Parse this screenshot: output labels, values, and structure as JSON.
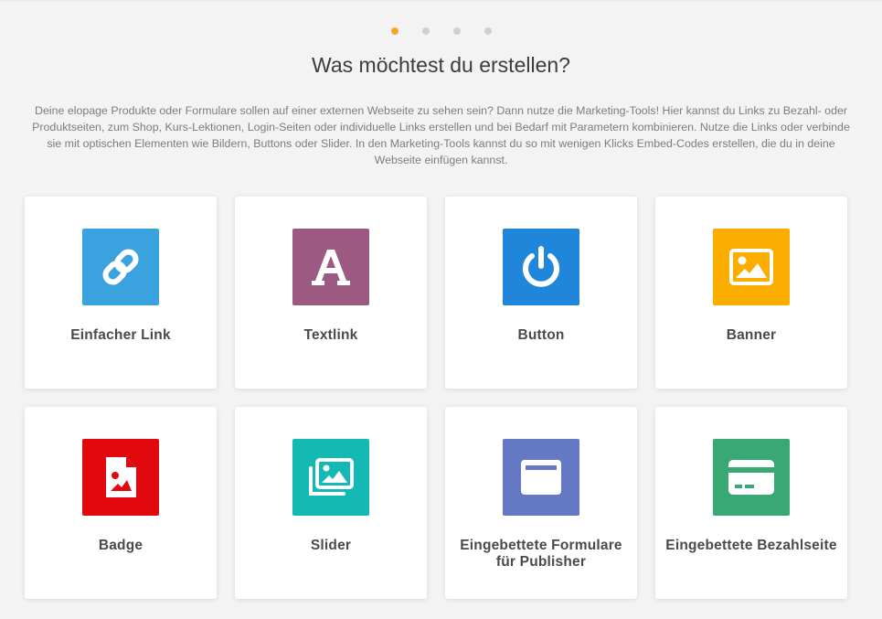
{
  "pagination": {
    "dots": [
      {
        "active": true
      },
      {
        "active": false
      },
      {
        "active": false
      },
      {
        "active": false
      }
    ]
  },
  "title": "Was möchtest du erstellen?",
  "description": "Deine elopage Produkte oder Formulare sollen auf einer externen Webseite zu sehen sein? Dann nutze die Marketing-Tools! Hier kannst du Links zu Bezahl- oder Produktseiten, zum Shop, Kurs-Lektionen, Login-Seiten oder individuelle Links erstellen und bei Bedarf mit Parametern kombinieren. Nutze die Links oder verbinde sie mit optischen Elementen wie Bildern, Buttons oder Slider. In den Marketing-Tools kannst du so mit wenigen Klicks Embed-Codes erstellen, die du in deine Webseite einfügen kannst.",
  "colors": {
    "active_dot": "#f5a623",
    "inactive_dot": "#cfcfcf"
  },
  "options": [
    {
      "label": "Einfacher Link",
      "icon": "link-icon",
      "color": "#3ba2e0"
    },
    {
      "label": "Textlink",
      "icon": "letter-a-icon",
      "color": "#9c5a82"
    },
    {
      "label": "Button",
      "icon": "power-icon",
      "color": "#1f86d9"
    },
    {
      "label": "Banner",
      "icon": "image-icon",
      "color": "#fbad00"
    },
    {
      "label": "Badge",
      "icon": "image-file-icon",
      "color": "#e1090d"
    },
    {
      "label": "Slider",
      "icon": "images-icon",
      "color": "#14b9b4"
    },
    {
      "label": "Eingebettete Formulare für Publisher",
      "icon": "browser-window-icon",
      "color": "#6478c6"
    },
    {
      "label": "Eingebettete Bezahlseite",
      "icon": "credit-card-icon",
      "color": "#39a872"
    }
  ]
}
